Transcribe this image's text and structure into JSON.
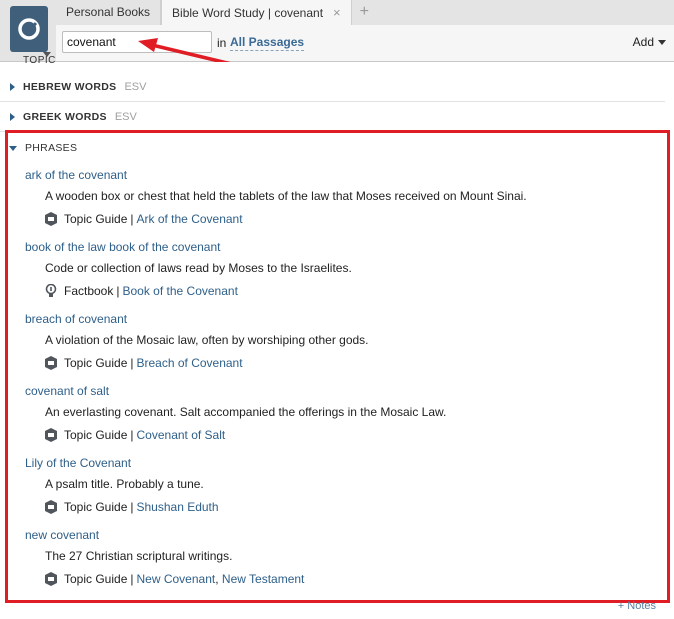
{
  "tabs": [
    {
      "label": "Personal Books",
      "active": false
    },
    {
      "label": "Bible Word Study | covenant",
      "active": true
    }
  ],
  "tab_close_glyph": "×",
  "tab_new_glyph": "+",
  "toolbar": {
    "search_value": "covenant",
    "in_label": "in",
    "passages_label": "All Passages",
    "add_label": "Add"
  },
  "sections": {
    "partial_label": "TOPIC",
    "hebrew": {
      "title": "HEBREW WORDS",
      "tag": "ESV"
    },
    "greek": {
      "title": "GREEK WORDS",
      "tag": "ESV"
    },
    "phrases": {
      "title": "PHRASES"
    }
  },
  "phrases": [
    {
      "title": "ark of the covenant",
      "alt": "",
      "description": "A wooden box or chest that held the tablets of the law that Moses received on Mount Sinai.",
      "source": "Topic Guide",
      "source_icon": "topic-guide-icon",
      "links": [
        "Ark of the Covenant"
      ]
    },
    {
      "title": "book of the law",
      "alt": "book of the covenant",
      "description": "Code or collection of laws read by Moses to the Israelites.",
      "source": "Factbook",
      "source_icon": "factbook-icon",
      "links": [
        "Book of the Covenant"
      ]
    },
    {
      "title": "breach of covenant",
      "alt": "",
      "description": "A violation of the Mosaic law, often by worshiping other gods.",
      "source": "Topic Guide",
      "source_icon": "topic-guide-icon",
      "links": [
        "Breach of Covenant"
      ]
    },
    {
      "title": "covenant of salt",
      "alt": "",
      "description": "An everlasting covenant. Salt accompanied the offerings in the Mosaic Law.",
      "source": "Topic Guide",
      "source_icon": "topic-guide-icon",
      "links": [
        "Covenant of Salt"
      ]
    },
    {
      "title": "Lily of the Covenant",
      "alt": "",
      "description": "A psalm title. Probably a tune.",
      "source": "Topic Guide",
      "source_icon": "topic-guide-icon",
      "links": [
        "Shushan Eduth"
      ]
    },
    {
      "title": "new covenant",
      "alt": "",
      "description": "The 27 Christian scriptural writings.",
      "source": "Topic Guide",
      "source_icon": "topic-guide-icon",
      "links": [
        "New Covenant",
        "New Testament"
      ]
    }
  ],
  "separators": {
    "pipe": "|",
    "comma": ","
  },
  "footer": {
    "notes_label": "+ Notes"
  },
  "colors": {
    "accent": "#2e5f89",
    "annotation": "#e01c24",
    "logo": "#3f5f7a"
  }
}
